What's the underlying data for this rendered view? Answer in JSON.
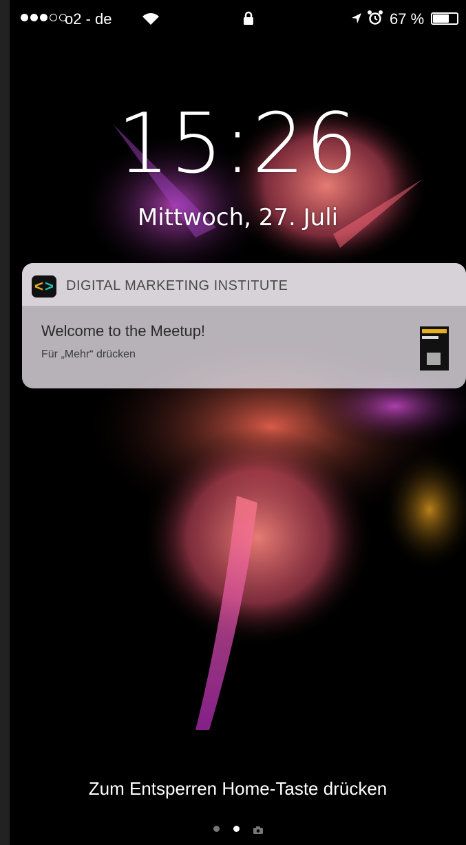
{
  "status_bar": {
    "carrier": "o2 - de",
    "battery_percent": "67 %",
    "battery_level": 0.67,
    "signal_strength": 3,
    "signal_max": 5
  },
  "lock": {
    "time": "15:26",
    "date": "Mittwoch, 27. Juli"
  },
  "notification": {
    "app_name": "DIGITAL MARKETING INSTITUTE",
    "title": "Welcome to the Meetup!",
    "subtitle": "Für „Mehr“ drücken"
  },
  "unlock_hint": "Zum Entsperren Home-Taste drücken",
  "pager": {
    "pages": 2,
    "current": 2
  },
  "colors": {
    "app_icon_left": "#e8b019",
    "app_icon_right": "#1fc4b1"
  },
  "icons": [
    "wifi-icon",
    "lock-icon",
    "location-arrow-icon",
    "alarm-icon",
    "battery-icon",
    "app-icon",
    "camera-icon"
  ]
}
